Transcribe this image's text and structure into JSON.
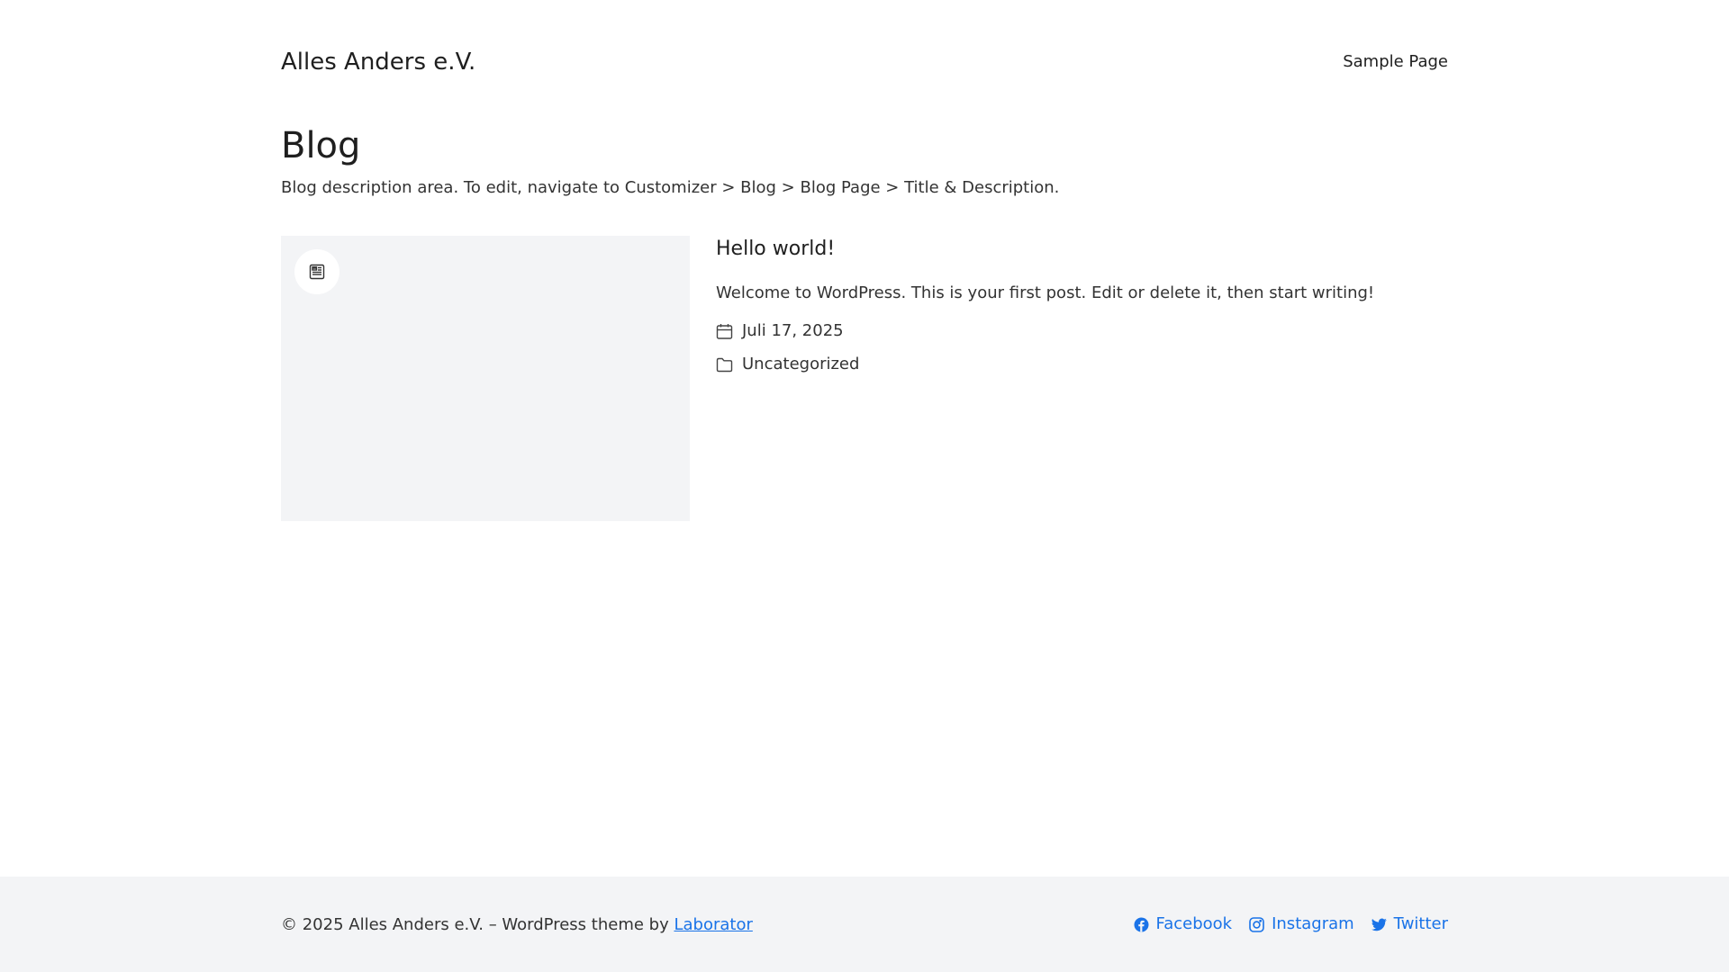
{
  "header": {
    "site_title": "Alles Anders e.V.",
    "nav": [
      "Sample Page"
    ]
  },
  "page": {
    "title": "Blog",
    "description": "Blog description area. To edit, navigate to Customizer > Blog > Blog Page > Title & Description."
  },
  "post": {
    "title": "Hello world!",
    "excerpt": "Welcome to WordPress. This is your first post. Edit or delete it, then start writing!",
    "date": "Juli 17, 2025",
    "category": "Uncategorized",
    "thumb_icon": "post-format-icon"
  },
  "footer": {
    "copyright_prefix": "© 2025 Alles Anders e.V. – WordPress theme by ",
    "theme_author": "Laborator",
    "social": [
      {
        "label": "Facebook",
        "icon": "facebook-icon"
      },
      {
        "label": "Instagram",
        "icon": "instagram-icon"
      },
      {
        "label": "Twitter",
        "icon": "twitter-icon"
      }
    ]
  },
  "colors": {
    "link": "#1a73e8",
    "footer_bg": "#f3f4f6",
    "thumb_bg": "#f3f4f6"
  }
}
